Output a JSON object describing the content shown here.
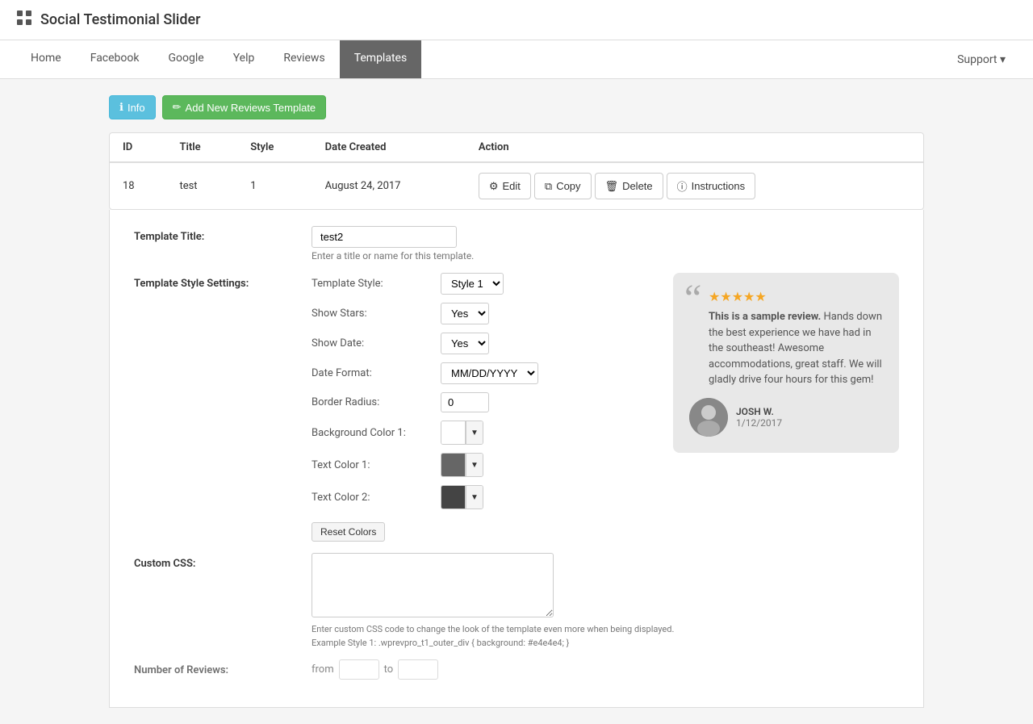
{
  "app": {
    "title": "Social Testimonial Slider",
    "icon": "grid-icon"
  },
  "nav": {
    "items": [
      {
        "label": "Home",
        "active": false
      },
      {
        "label": "Facebook",
        "active": false
      },
      {
        "label": "Google",
        "active": false
      },
      {
        "label": "Yelp",
        "active": false
      },
      {
        "label": "Reviews",
        "active": false
      },
      {
        "label": "Templates",
        "active": true
      }
    ],
    "support_label": "Support ▾"
  },
  "toolbar": {
    "info_label": "Info",
    "add_template_label": "Add New Reviews Template"
  },
  "table": {
    "columns": [
      "ID",
      "Title",
      "Style",
      "Date Created",
      "Action"
    ],
    "rows": [
      {
        "id": "18",
        "title": "test",
        "style": "1",
        "date_created": "August 24, 2017",
        "actions": [
          "Edit",
          "Copy",
          "Delete",
          "Instructions"
        ]
      }
    ]
  },
  "form": {
    "template_title_label": "Template Title:",
    "template_title_value": "test2",
    "template_title_hint": "Enter a title or name for this template.",
    "style_settings_label": "Template Style Settings:",
    "template_style_label": "Template Style:",
    "template_style_value": "Style 1",
    "show_stars_label": "Show Stars:",
    "show_stars_value": "Yes",
    "show_date_label": "Show Date:",
    "show_date_value": "Yes",
    "date_format_label": "Date Format:",
    "date_format_value": "MM/DD/YYYY",
    "border_radius_label": "Border Radius:",
    "border_radius_value": "0",
    "bg_color_label": "Background Color 1:",
    "text_color1_label": "Text Color 1:",
    "text_color2_label": "Text Color 2:",
    "reset_colors_label": "Reset Colors",
    "custom_css_label": "Custom CSS:",
    "custom_css_hint": "Enter custom CSS code to change the look of the template even more when being displayed.",
    "custom_css_example": "Example Style 1: .wprevpro_t1_outer_div { background: #e4e4e4; }",
    "number_of_reviews_label": "Number of Reviews:"
  },
  "preview": {
    "stars": "★★★★★",
    "review_text": "This is a sample review. Hands down the best experience we have had in the southeast! Awesome accommodations, great staff. We will gladly drive four hours for this gem!",
    "author_name": "JOSH W.",
    "author_date": "1/12/2017"
  }
}
